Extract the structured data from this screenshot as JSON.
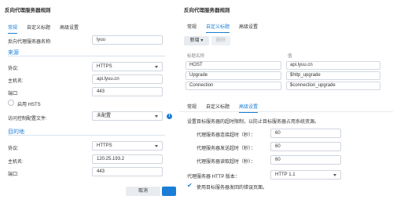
{
  "left": {
    "title": "反向代理服务器规则",
    "tabs": [
      "常规",
      "自定义标题",
      "高级设置"
    ],
    "active_tab": 0,
    "name_label": "反向代理服务器名称:",
    "name_value": "lyuu",
    "source_section": "来源",
    "source": {
      "protocol_label": "协议:",
      "protocol_value": "HTTPS",
      "host_label": "主机名:",
      "host_value": "api.lyuu.cn",
      "port_label": "端口:",
      "port_value": "443",
      "hsts_label": "启用 HSTS",
      "acl_label": "访问控制配置文件:",
      "acl_value": "未配置"
    },
    "dest_section": "目的地",
    "dest": {
      "protocol_label": "协议:",
      "protocol_value": "HTTPS",
      "host_label": "主机名:",
      "host_value": "120.25.193.2",
      "port_label": "端口:",
      "port_value": "443"
    },
    "cancel_label": "取消"
  },
  "right_top": {
    "title": "反向代理服务器规则",
    "tabs": [
      "常规",
      "自定义标题",
      "高级设置"
    ],
    "active_tab": 1,
    "add_label": "新增 ▾",
    "delete_label": "删除",
    "col_name": "标题名称",
    "col_value": "值",
    "rows": [
      {
        "name": "HOST",
        "value": "api.lyuu.cn"
      },
      {
        "name": "Upgrade",
        "value": "$http_upgrade"
      },
      {
        "name": "Connection",
        "value": "$connection_upgrade"
      }
    ]
  },
  "right_bottom": {
    "tabs": [
      "常规",
      "自定义标题",
      "高级设置"
    ],
    "active_tab": 2,
    "desc": "设置目标服务器的超时限制，以防止目标服务器占用系统资源。",
    "connect_label": "代理服务器连接超时（秒）：",
    "connect_value": "60",
    "send_label": "代理服务器发送超时（秒）：",
    "send_value": "60",
    "read_label": "代理服务器读取超时（秒）：",
    "read_value": "60",
    "http_label": "代理服务器 HTTP 版本：",
    "http_value": "HTTP 1.1",
    "errpage_label": "使用目标服务器发回的错误页面。"
  }
}
